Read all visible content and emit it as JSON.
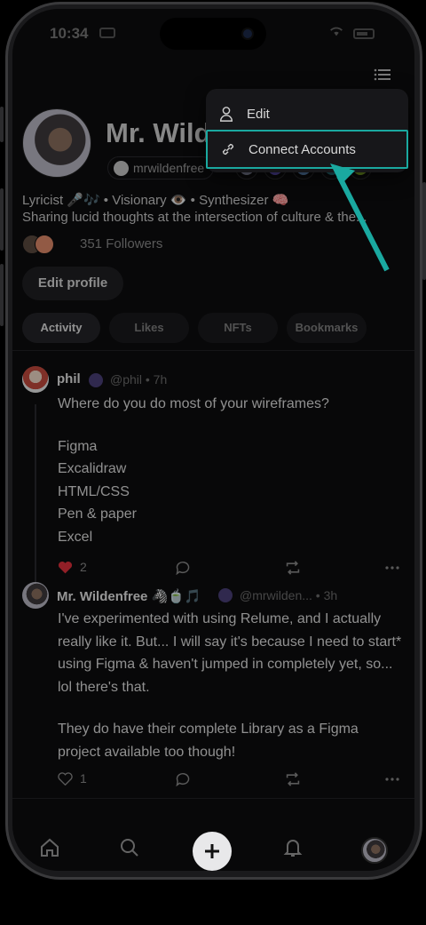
{
  "status_bar": {
    "time": "10:34"
  },
  "profile": {
    "name": "Mr. Wilde",
    "handle": "mrwildenfree",
    "bio_line_1": "Lyricist 🎤🎶 • Visionary 👁️ • Synthesizer 🧠",
    "bio_line_2": "Sharing lucid thoughts at the intersection of culture & the...",
    "followers": "351 Followers",
    "edit_profile_label": "Edit profile"
  },
  "badges": [
    {
      "icon": "ethereum-icon",
      "color": "#9aa0b8"
    },
    {
      "icon": "nouns-icon",
      "color": "#6b5ad1"
    },
    {
      "icon": "blue-orb-icon",
      "color": "#6a9fd8"
    },
    {
      "icon": "teal-orb-icon",
      "color": "#2a7f8a"
    },
    {
      "icon": "green-sprite-icon",
      "color": "#8fbf2a"
    }
  ],
  "tabs": [
    {
      "label": "Activity",
      "active": true
    },
    {
      "label": "Likes",
      "active": false
    },
    {
      "label": "NFTs",
      "active": false
    },
    {
      "label": "Bookmarks",
      "active": false
    }
  ],
  "posts": [
    {
      "name": "phil",
      "meta": "@phil • 7h",
      "body": [
        "Where do you do most of your wireframes?",
        "",
        "Figma",
        "Excalidraw",
        "HTML/CSS",
        "Pen & paper",
        "Excel"
      ],
      "likes": "2",
      "liked": true
    },
    {
      "name": "Mr. Wildenfree 🦓🍵🎵",
      "meta": "@mrwilden... • 3h",
      "body": [
        "I've experimented with using Relume, and I actually really like it. But... I will say it's because I need to start* using Figma & haven't jumped in completely yet, so... lol there's that.",
        "",
        "They do have their complete Library as a Figma project available too though!"
      ],
      "likes": "1",
      "liked": false
    }
  ],
  "dropdown": {
    "edit_label": "Edit",
    "connect_label": "Connect Accounts"
  },
  "colors": {
    "accent_highlight": "#1aa9a0",
    "like_red": "#e0313c",
    "background": "#0d0d0f"
  }
}
